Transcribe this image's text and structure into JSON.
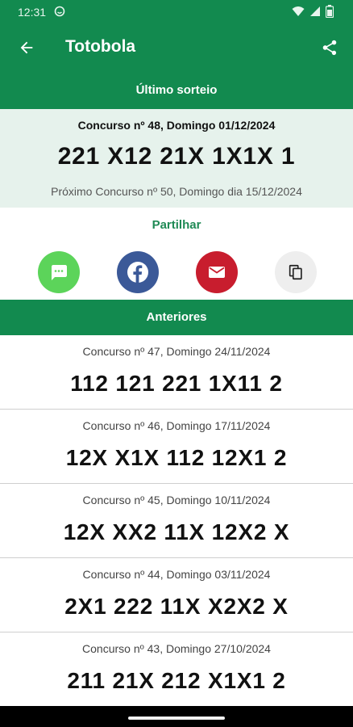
{
  "status": {
    "time": "12:31"
  },
  "app_bar": {
    "title": "Totobola"
  },
  "latest": {
    "header": "Último sorteio",
    "contest": "Concurso nº 48, Domingo 01/12/2024",
    "result": "221 X12 21X 1X1X 1",
    "next": "Próximo Concurso nº 50, Domingo dia 15/12/2024"
  },
  "share": {
    "label": "Partilhar",
    "icons": [
      "message-icon",
      "facebook-icon",
      "mail-icon",
      "copy-icon"
    ],
    "colors": {
      "sms": "#5cd45a",
      "facebook": "#3b5998",
      "mail": "#c81d2e",
      "copy": "#eeeeee"
    }
  },
  "previous": {
    "header": "Anteriores",
    "items": [
      {
        "contest": "Concurso nº 47, Domingo 24/11/2024",
        "result": "112 121 221 1X11 2"
      },
      {
        "contest": "Concurso nº 46, Domingo 17/11/2024",
        "result": "12X X1X 112 12X1 2"
      },
      {
        "contest": "Concurso nº 45, Domingo 10/11/2024",
        "result": "12X XX2 11X 12X2 X"
      },
      {
        "contest": "Concurso nº 44, Domingo 03/11/2024",
        "result": "2X1 222 11X X2X2 X"
      },
      {
        "contest": "Concurso nº 43, Domingo 27/10/2024",
        "result": "211 21X 212 X1X1 2"
      }
    ]
  },
  "theme": {
    "primary": "#128a4f",
    "latest_bg": "#e6f2ec",
    "accent_text": "#1f8a55"
  }
}
